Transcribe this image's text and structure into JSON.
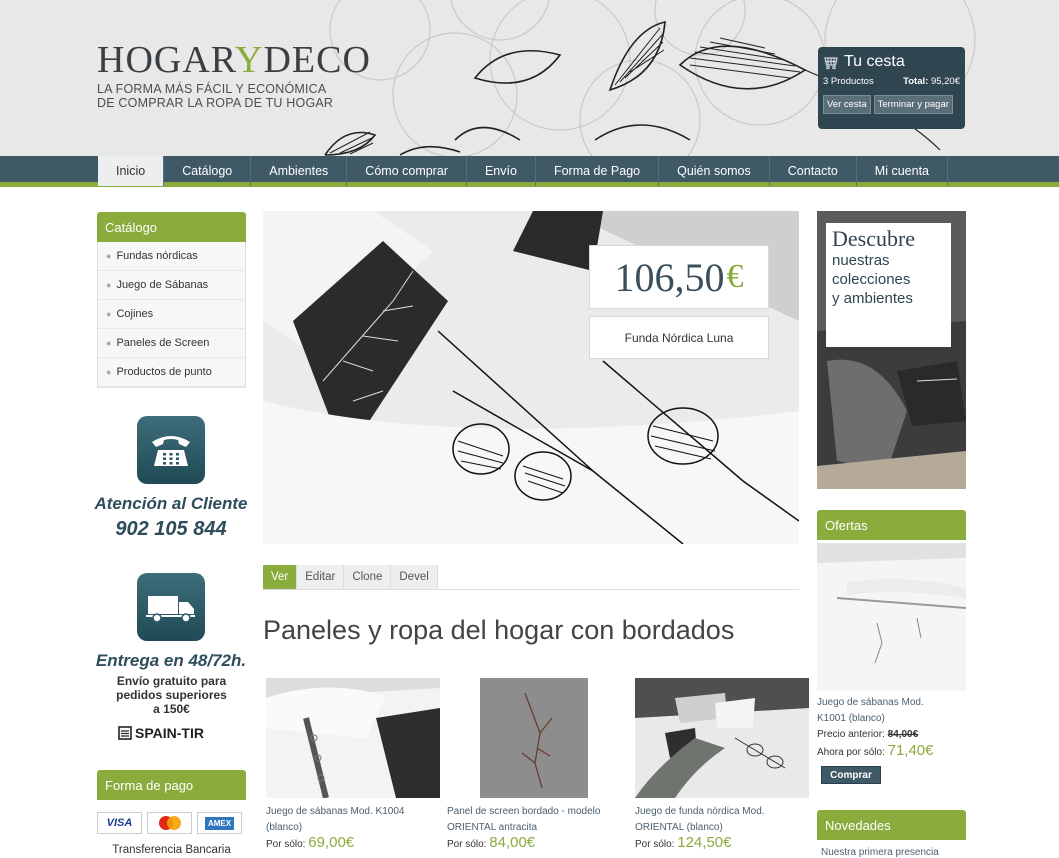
{
  "brand": {
    "name_part1": "HOGAR",
    "name_y": "Y",
    "name_part2": "DECO",
    "tagline_line1": "LA FORMA MÁS FÁCIL Y ECONÓMICA",
    "tagline_line2": "DE COMPRAR LA ROPA DE TU HOGAR"
  },
  "cart": {
    "title": "Tu cesta",
    "products": "3 Productos",
    "total_label": "Total:",
    "total_value": "95,20€",
    "view_label": "Ver cesta",
    "checkout_label": "Terminar y pagar"
  },
  "nav": {
    "items": [
      "Inicio",
      "Catálogo",
      "Ambientes",
      "Cómo comprar",
      "Envío",
      "Forma de Pago",
      "Quién somos",
      "Contacto",
      "Mi cuenta"
    ]
  },
  "catalog": {
    "title": "Catálogo",
    "items": [
      "Fundas nórdicas",
      "Juego de Sábanas",
      "Cojines",
      "Paneles de Screen",
      "Productos de punto"
    ]
  },
  "service": {
    "title": "Atención al Cliente",
    "phone": "902 105 844"
  },
  "delivery": {
    "title": "Entrega en 48/72h.",
    "note_line1": "Envío gratuito para",
    "note_line2": "pedidos superiores",
    "note_prefix": "a ",
    "note_amount": "150€",
    "carrier": "SPAIN-TIR"
  },
  "payment": {
    "title": "Forma de pago",
    "cards": [
      "VISA",
      "AMEX"
    ],
    "note": "Transferencia Bancaria"
  },
  "hero": {
    "price": "106,50",
    "currency": "€",
    "product": "Funda Nórdica Luna"
  },
  "tabs": [
    "Ver",
    "Editar",
    "Clone",
    "Devel"
  ],
  "page_title": "Paneles y ropa del hogar con bordados",
  "products": [
    {
      "name_line1": "Juego de sábanas Mod. K1004",
      "name_line2": "(blanco)",
      "price_label": "Por sólo:",
      "price": "69,00€"
    },
    {
      "name_line1": "Panel de screen bordado - modelo",
      "name_line2": "ORIENTAL antracita",
      "price_label": "Por sólo:",
      "price": "84,00€"
    },
    {
      "name_line1": "Juego de funda nórdica Mod.",
      "name_line2": "ORIENTAL (blanco)",
      "price_label": "Por sólo:",
      "price": "124,50€"
    }
  ],
  "promo": {
    "title": "Descubre",
    "line1": "nuestras",
    "line2": "colecciones",
    "line3": "y ambientes"
  },
  "offers": {
    "title": "Ofertas",
    "name_line1": "Juego de sábanas Mod.",
    "name_line2": "K1001 (blanco)",
    "prev_label": "Precio anterior:",
    "prev_price": "84,00€",
    "now_label": "Ahora por sólo:",
    "now_price": "71,40€",
    "buy_label": "Comprar"
  },
  "news": {
    "title": "Novedades",
    "text": "Nuestra primera presencia"
  },
  "colors": {
    "accent": "#8aac3c",
    "nav_bg": "#3f5966",
    "cart_bg": "#2f4550"
  }
}
